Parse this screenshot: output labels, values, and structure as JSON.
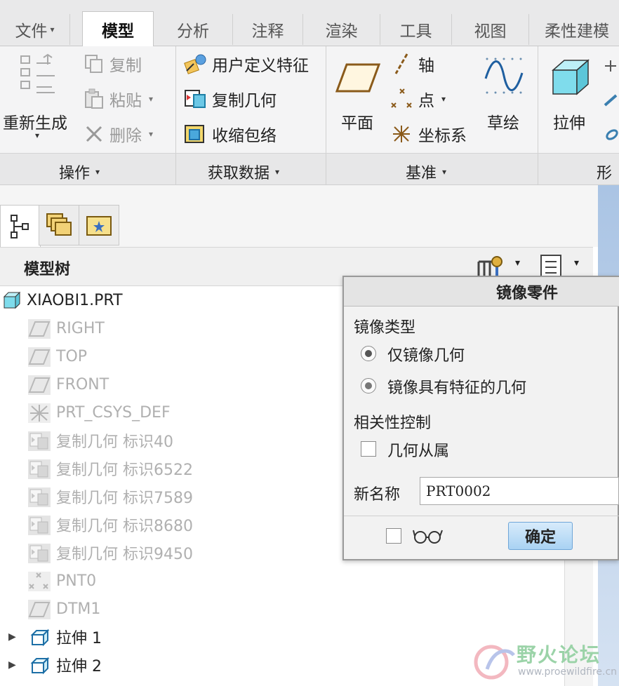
{
  "tabs": [
    {
      "label": "文件",
      "arrow": "▾",
      "active": false
    },
    {
      "label": "模型",
      "active": true
    },
    {
      "label": "分析",
      "active": false
    },
    {
      "label": "注释",
      "active": false
    },
    {
      "label": "渲染",
      "active": false
    },
    {
      "label": "工具",
      "active": false
    },
    {
      "label": "视图",
      "active": false
    },
    {
      "label": "柔性建模",
      "active": false
    }
  ],
  "ribbon": {
    "operations": {
      "regenerate": "重新生成",
      "copy": "复制",
      "paste": "粘贴",
      "delete": "删除",
      "group_label": "操作"
    },
    "get_data": {
      "udf": "用户定义特征",
      "copy_geom": "复制几何",
      "shrinkwrap": "收缩包络",
      "group_label": "获取数据"
    },
    "datum": {
      "plane": "平面",
      "axis": "轴",
      "point": "点",
      "csys": "坐标系",
      "sketch": "草绘",
      "group_label": "基准"
    },
    "shapes": {
      "extrude": "拉伸",
      "group_label": "形状"
    },
    "dropdown_glyph": "▾"
  },
  "model_tree": {
    "header": "模型树",
    "items": [
      {
        "label": "XIAOBI1.PRT",
        "icon": "part-icon",
        "dim": false
      },
      {
        "label": "RIGHT",
        "icon": "datum-plane-icon",
        "dim": true
      },
      {
        "label": "TOP",
        "icon": "datum-plane-icon",
        "dim": true
      },
      {
        "label": "FRONT",
        "icon": "datum-plane-icon",
        "dim": true
      },
      {
        "label": "PRT_CSYS_DEF",
        "icon": "csys-icon",
        "dim": true
      },
      {
        "label": "复制几何 标识40",
        "icon": "copy-geom-icon",
        "dim": true
      },
      {
        "label": "复制几何 标识6522",
        "icon": "copy-geom-icon",
        "dim": true
      },
      {
        "label": "复制几何 标识7589",
        "icon": "copy-geom-icon",
        "dim": true
      },
      {
        "label": "复制几何 标识8680",
        "icon": "copy-geom-icon",
        "dim": true
      },
      {
        "label": "复制几何 标识9450",
        "icon": "copy-geom-icon",
        "dim": true
      },
      {
        "label": "PNT0",
        "icon": "datum-point-icon",
        "dim": true
      },
      {
        "label": "DTM1",
        "icon": "datum-plane-icon",
        "dim": true
      },
      {
        "label": "拉伸 1",
        "icon": "extrude-icon",
        "dim": false
      },
      {
        "label": "拉伸 2",
        "icon": "extrude-icon",
        "dim": false
      }
    ]
  },
  "dialog": {
    "title": "镜像零件",
    "mirror_type_label": "镜像类型",
    "option_geometry_only": "仅镜像几何",
    "option_with_features": "镜像具有特征的几何",
    "dependency_label": "相关性控制",
    "geometry_dependent": "几何从属",
    "new_name_label": "新名称",
    "new_name_value": "PRT0002",
    "ok_label": "确定"
  },
  "watermark": {
    "title": "野火论坛",
    "url": "www.proewildfire.cn"
  },
  "colors": {
    "ok_button": "#a9d2f3",
    "right_strip": "#aac4e4",
    "watermark": "#9bd3a8"
  }
}
